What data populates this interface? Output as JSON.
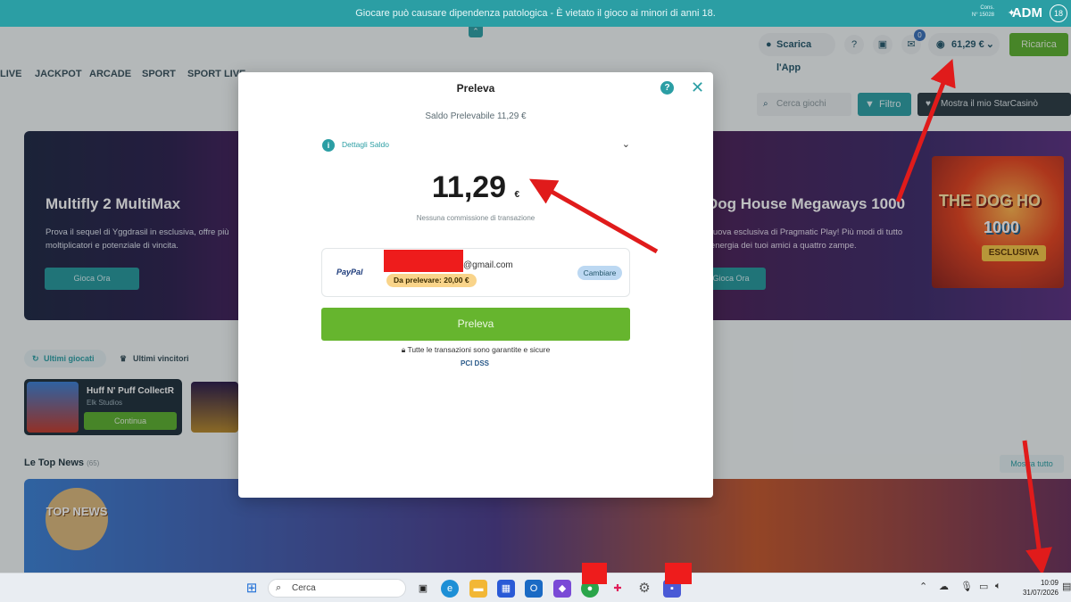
{
  "banner": {
    "message": "Giocare può causare dipendenza patologica - È vietato il gioco ai minori di anni 18.",
    "code_label": "Cons.",
    "code_value": "N° 15028",
    "adm": "ADM",
    "age": "18"
  },
  "header": {
    "app_label": "Scarica l'App",
    "messages_badge": "0",
    "balance": "61,29 €",
    "recharge_label": "Ricarica"
  },
  "nav": [
    "LIVE",
    "JACKPOT",
    "ARCADE",
    "SPORT",
    "SPORT LIVE"
  ],
  "toolbar": {
    "search_placeholder": "Cerca giochi",
    "filter_label": "Filtro",
    "show_my_label": "Mostra il mio StarCasinò"
  },
  "hero_left": {
    "title": "Multifly 2 MultiMax",
    "description": "Prova il sequel di Yggdrasil in esclusiva, offre più moltiplicatori e potenziale di vincita.",
    "cta": "Gioca Ora"
  },
  "hero_right": {
    "title": "Dog House Megaways 1000",
    "description": "Nuova esclusiva di Pragmatic Play! Più modi di tutto l'energia dei tuoi amici a quattro zampe.",
    "cta": "Gioca Ora",
    "art_title": "THE DOG HO",
    "art_number": "1000",
    "art_tag": "ESCLUSIVA"
  },
  "recent": {
    "tab_recent": "Ultimi giocati",
    "tab_winners": "Ultimi vincitori",
    "game_name": "Huff N' Puff CollectR",
    "game_studio": "Elk Studios",
    "continue_label": "Continua"
  },
  "news": {
    "title": "Le Top News",
    "count": "(65)",
    "see_all": "Mostra tutto",
    "badge": "TOP NEWS"
  },
  "modal": {
    "title": "Preleva",
    "withdrawable": "Saldo Prelevabile 11,29 €",
    "details_label": "Dettagli Saldo",
    "amount": "11,29",
    "currency": "€",
    "no_commission": "Nessuna commissione di transazione",
    "method_name": "PayPal",
    "email_suffix": "@gmail.com",
    "limit": "Da prelevare: 20,00 €",
    "change_label": "Cambiare",
    "withdraw_label": "Preleva",
    "secure_text": "Tutte le transazioni sono garantite e sicure",
    "pci_label": "PCI DSS"
  },
  "taskbar": {
    "search_label": "Cerca",
    "time": "10:09",
    "date": "31/07/2026"
  },
  "colors": {
    "brand_teal": "#2b9ea4",
    "primary_green": "#66b52e",
    "annotation_red": "#e01b1b"
  }
}
